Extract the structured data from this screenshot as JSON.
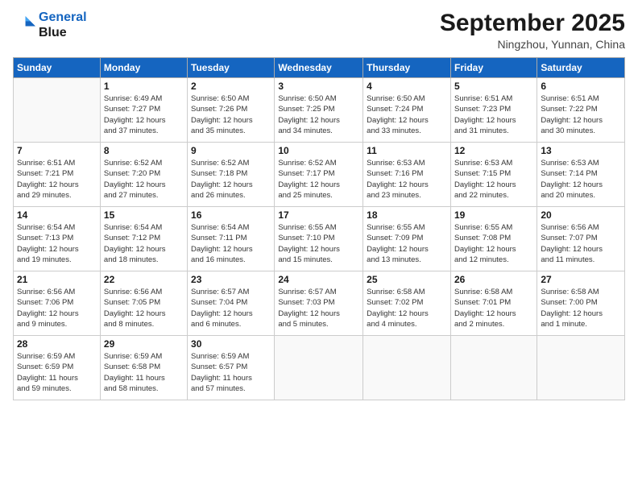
{
  "logo": {
    "line1": "General",
    "line2": "Blue"
  },
  "title": "September 2025",
  "location": "Ningzhou, Yunnan, China",
  "days_header": [
    "Sunday",
    "Monday",
    "Tuesday",
    "Wednesday",
    "Thursday",
    "Friday",
    "Saturday"
  ],
  "weeks": [
    [
      {
        "day": "",
        "info": ""
      },
      {
        "day": "1",
        "info": "Sunrise: 6:49 AM\nSunset: 7:27 PM\nDaylight: 12 hours\nand 37 minutes."
      },
      {
        "day": "2",
        "info": "Sunrise: 6:50 AM\nSunset: 7:26 PM\nDaylight: 12 hours\nand 35 minutes."
      },
      {
        "day": "3",
        "info": "Sunrise: 6:50 AM\nSunset: 7:25 PM\nDaylight: 12 hours\nand 34 minutes."
      },
      {
        "day": "4",
        "info": "Sunrise: 6:50 AM\nSunset: 7:24 PM\nDaylight: 12 hours\nand 33 minutes."
      },
      {
        "day": "5",
        "info": "Sunrise: 6:51 AM\nSunset: 7:23 PM\nDaylight: 12 hours\nand 31 minutes."
      },
      {
        "day": "6",
        "info": "Sunrise: 6:51 AM\nSunset: 7:22 PM\nDaylight: 12 hours\nand 30 minutes."
      }
    ],
    [
      {
        "day": "7",
        "info": "Sunrise: 6:51 AM\nSunset: 7:21 PM\nDaylight: 12 hours\nand 29 minutes."
      },
      {
        "day": "8",
        "info": "Sunrise: 6:52 AM\nSunset: 7:20 PM\nDaylight: 12 hours\nand 27 minutes."
      },
      {
        "day": "9",
        "info": "Sunrise: 6:52 AM\nSunset: 7:18 PM\nDaylight: 12 hours\nand 26 minutes."
      },
      {
        "day": "10",
        "info": "Sunrise: 6:52 AM\nSunset: 7:17 PM\nDaylight: 12 hours\nand 25 minutes."
      },
      {
        "day": "11",
        "info": "Sunrise: 6:53 AM\nSunset: 7:16 PM\nDaylight: 12 hours\nand 23 minutes."
      },
      {
        "day": "12",
        "info": "Sunrise: 6:53 AM\nSunset: 7:15 PM\nDaylight: 12 hours\nand 22 minutes."
      },
      {
        "day": "13",
        "info": "Sunrise: 6:53 AM\nSunset: 7:14 PM\nDaylight: 12 hours\nand 20 minutes."
      }
    ],
    [
      {
        "day": "14",
        "info": "Sunrise: 6:54 AM\nSunset: 7:13 PM\nDaylight: 12 hours\nand 19 minutes."
      },
      {
        "day": "15",
        "info": "Sunrise: 6:54 AM\nSunset: 7:12 PM\nDaylight: 12 hours\nand 18 minutes."
      },
      {
        "day": "16",
        "info": "Sunrise: 6:54 AM\nSunset: 7:11 PM\nDaylight: 12 hours\nand 16 minutes."
      },
      {
        "day": "17",
        "info": "Sunrise: 6:55 AM\nSunset: 7:10 PM\nDaylight: 12 hours\nand 15 minutes."
      },
      {
        "day": "18",
        "info": "Sunrise: 6:55 AM\nSunset: 7:09 PM\nDaylight: 12 hours\nand 13 minutes."
      },
      {
        "day": "19",
        "info": "Sunrise: 6:55 AM\nSunset: 7:08 PM\nDaylight: 12 hours\nand 12 minutes."
      },
      {
        "day": "20",
        "info": "Sunrise: 6:56 AM\nSunset: 7:07 PM\nDaylight: 12 hours\nand 11 minutes."
      }
    ],
    [
      {
        "day": "21",
        "info": "Sunrise: 6:56 AM\nSunset: 7:06 PM\nDaylight: 12 hours\nand 9 minutes."
      },
      {
        "day": "22",
        "info": "Sunrise: 6:56 AM\nSunset: 7:05 PM\nDaylight: 12 hours\nand 8 minutes."
      },
      {
        "day": "23",
        "info": "Sunrise: 6:57 AM\nSunset: 7:04 PM\nDaylight: 12 hours\nand 6 minutes."
      },
      {
        "day": "24",
        "info": "Sunrise: 6:57 AM\nSunset: 7:03 PM\nDaylight: 12 hours\nand 5 minutes."
      },
      {
        "day": "25",
        "info": "Sunrise: 6:58 AM\nSunset: 7:02 PM\nDaylight: 12 hours\nand 4 minutes."
      },
      {
        "day": "26",
        "info": "Sunrise: 6:58 AM\nSunset: 7:01 PM\nDaylight: 12 hours\nand 2 minutes."
      },
      {
        "day": "27",
        "info": "Sunrise: 6:58 AM\nSunset: 7:00 PM\nDaylight: 12 hours\nand 1 minute."
      }
    ],
    [
      {
        "day": "28",
        "info": "Sunrise: 6:59 AM\nSunset: 6:59 PM\nDaylight: 11 hours\nand 59 minutes."
      },
      {
        "day": "29",
        "info": "Sunrise: 6:59 AM\nSunset: 6:58 PM\nDaylight: 11 hours\nand 58 minutes."
      },
      {
        "day": "30",
        "info": "Sunrise: 6:59 AM\nSunset: 6:57 PM\nDaylight: 11 hours\nand 57 minutes."
      },
      {
        "day": "",
        "info": ""
      },
      {
        "day": "",
        "info": ""
      },
      {
        "day": "",
        "info": ""
      },
      {
        "day": "",
        "info": ""
      }
    ]
  ]
}
